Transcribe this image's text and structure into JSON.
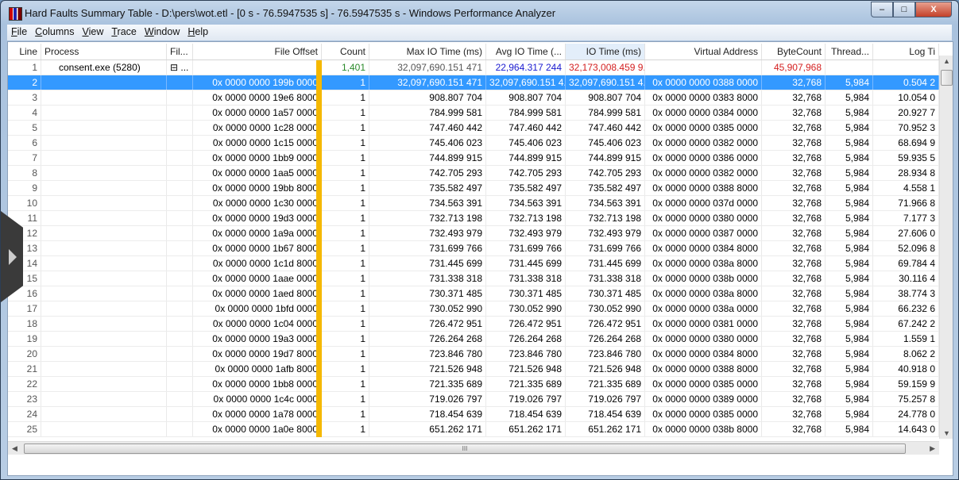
{
  "window": {
    "title": "Hard Faults Summary Table - D:\\pers\\wot.etl - [0 s - 76.5947535 s] - 76.5947535 s - Windows Performance Analyzer",
    "minimize": "–",
    "maximize": "□",
    "close": "X"
  },
  "menu": [
    {
      "label": "File",
      "u": "F",
      "rest": "ile"
    },
    {
      "label": "Columns",
      "u": "C",
      "rest": "olumns"
    },
    {
      "label": "View",
      "u": "V",
      "rest": "iew"
    },
    {
      "label": "Trace",
      "u": "T",
      "rest": "race"
    },
    {
      "label": "Window",
      "u": "W",
      "rest": "indow"
    },
    {
      "label": "Help",
      "u": "H",
      "rest": "elp"
    }
  ],
  "columns": [
    "Line",
    "Process",
    "Fil...",
    "File Offset",
    "Count",
    "Max IO Time (ms)",
    "Avg IO Time (...",
    "IO Time (ms)",
    "Virtual Address",
    "ByteCount",
    "Thread...",
    "Log Ti"
  ],
  "sorted_column": "IO Time (ms)",
  "colors": {
    "selection": "#3399ff",
    "gold_bar": "#f5b800",
    "count_total": "#2a8a2a",
    "avg_total": "#1a1ad0",
    "totals_red": "#d42020"
  },
  "group_row": {
    "line": "1",
    "process": "consent.exe (5280)",
    "expander": "⊟",
    "fil": "...",
    "count": "1,401",
    "max": "32,097,690.151 471",
    "avg": "22,964.317 244",
    "io": "32,173,008.459 9...",
    "bytecount": "45,907,968"
  },
  "selected_row": {
    "line": "2",
    "offset": "0x 0000 0000 199b 0000",
    "count": "1",
    "max": "32,097,690.151 471",
    "avg": "32,097,690.151 4...",
    "io": "32,097,690.151 4...",
    "va": "0x 0000 0000 0388 0000",
    "bytecount": "32,768",
    "thread": "5,984",
    "log": "0.504 2"
  },
  "rows": [
    [
      "3",
      "0x 0000 0000 19e6 8000",
      "1",
      "908.807 704",
      "0x 0000 0000 0383 8000",
      "32,768",
      "5,984",
      "10.054 0"
    ],
    [
      "4",
      "0x 0000 0000 1a57 0000",
      "1",
      "784.999 581",
      "0x 0000 0000 0384 0000",
      "32,768",
      "5,984",
      "20.927 7"
    ],
    [
      "5",
      "0x 0000 0000 1c28 0000",
      "1",
      "747.460 442",
      "0x 0000 0000 0385 0000",
      "32,768",
      "5,984",
      "70.952 3"
    ],
    [
      "6",
      "0x 0000 0000 1c15 0000",
      "1",
      "745.406 023",
      "0x 0000 0000 0382 0000",
      "32,768",
      "5,984",
      "68.694 9"
    ],
    [
      "7",
      "0x 0000 0000 1bb9 0000",
      "1",
      "744.899 915",
      "0x 0000 0000 0386 0000",
      "32,768",
      "5,984",
      "59.935 5"
    ],
    [
      "8",
      "0x 0000 0000 1aa5 0000",
      "1",
      "742.705 293",
      "0x 0000 0000 0382 0000",
      "32,768",
      "5,984",
      "28.934 8"
    ],
    [
      "9",
      "0x 0000 0000 19bb 8000",
      "1",
      "735.582 497",
      "0x 0000 0000 0388 8000",
      "32,768",
      "5,984",
      "4.558 1"
    ],
    [
      "10",
      "0x 0000 0000 1c30 0000",
      "1",
      "734.563 391",
      "0x 0000 0000 037d 0000",
      "32,768",
      "5,984",
      "71.966 8"
    ],
    [
      "11",
      "0x 0000 0000 19d3 0000",
      "1",
      "732.713 198",
      "0x 0000 0000 0380 0000",
      "32,768",
      "5,984",
      "7.177 3"
    ],
    [
      "12",
      "0x 0000 0000 1a9a 0000",
      "1",
      "732.493 979",
      "0x 0000 0000 0387 0000",
      "32,768",
      "5,984",
      "27.606 0"
    ],
    [
      "13",
      "0x 0000 0000 1b67 8000",
      "1",
      "731.699 766",
      "0x 0000 0000 0384 8000",
      "32,768",
      "5,984",
      "52.096 8"
    ],
    [
      "14",
      "0x 0000 0000 1c1d 8000",
      "1",
      "731.445 699",
      "0x 0000 0000 038a 8000",
      "32,768",
      "5,984",
      "69.784 4"
    ],
    [
      "15",
      "0x 0000 0000 1aae 0000",
      "1",
      "731.338 318",
      "0x 0000 0000 038b 0000",
      "32,768",
      "5,984",
      "30.116 4"
    ],
    [
      "16",
      "0x 0000 0000 1aed 8000",
      "1",
      "730.371 485",
      "0x 0000 0000 038a 8000",
      "32,768",
      "5,984",
      "38.774 3"
    ],
    [
      "17",
      "0x 0000 0000 1bfd 0000",
      "1",
      "730.052 990",
      "0x 0000 0000 038a 0000",
      "32,768",
      "5,984",
      "66.232 6"
    ],
    [
      "18",
      "0x 0000 0000 1c04 0000",
      "1",
      "726.472 951",
      "0x 0000 0000 0381 0000",
      "32,768",
      "5,984",
      "67.242 2"
    ],
    [
      "19",
      "0x 0000 0000 19a3 0000",
      "1",
      "726.264 268",
      "0x 0000 0000 0380 0000",
      "32,768",
      "5,984",
      "1.559 1"
    ],
    [
      "20",
      "0x 0000 0000 19d7 8000",
      "1",
      "723.846 780",
      "0x 0000 0000 0384 8000",
      "32,768",
      "5,984",
      "8.062 2"
    ],
    [
      "21",
      "0x 0000 0000 1afb 8000",
      "1",
      "721.526 948",
      "0x 0000 0000 0388 8000",
      "32,768",
      "5,984",
      "40.918 0"
    ],
    [
      "22",
      "0x 0000 0000 1bb8 0000",
      "1",
      "721.335 689",
      "0x 0000 0000 0385 0000",
      "32,768",
      "5,984",
      "59.159 9"
    ],
    [
      "23",
      "0x 0000 0000 1c4c 0000",
      "1",
      "719.026 797",
      "0x 0000 0000 0389 0000",
      "32,768",
      "5,984",
      "75.257 8"
    ],
    [
      "24",
      "0x 0000 0000 1a78 0000",
      "1",
      "718.454 639",
      "0x 0000 0000 0385 0000",
      "32,768",
      "5,984",
      "24.778 0"
    ],
    [
      "25",
      "0x 0000 0000 1a0e 8000",
      "1",
      "651.262 171",
      "0x 0000 0000 038b 8000",
      "32,768",
      "5,984",
      "14.643 0"
    ]
  ],
  "scrollbar": {
    "grip": "III",
    "up": "▲",
    "down": "▼",
    "left": "◀",
    "right": "▶"
  }
}
